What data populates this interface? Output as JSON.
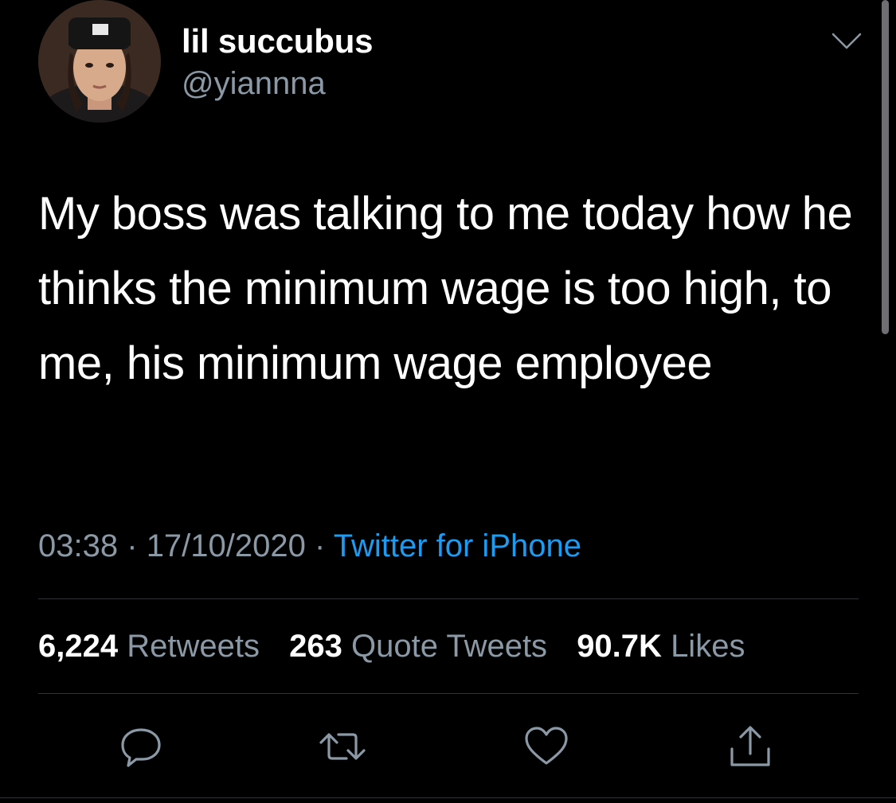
{
  "user": {
    "display_name": "lil succubus",
    "handle": "@yiannna"
  },
  "tweet": {
    "text": "My boss was talking to me today how he thinks the minimum wage is too high, to me, his minimum wage employee"
  },
  "meta": {
    "time": "03:38",
    "separator": "·",
    "date": "17/10/2020",
    "source": "Twitter for iPhone"
  },
  "stats": {
    "retweets_count": "6,224",
    "retweets_label": "Retweets",
    "quotes_count": "263",
    "quotes_label": "Quote Tweets",
    "likes_count": "90.7K",
    "likes_label": "Likes"
  },
  "icons": {
    "more": "chevron-down-icon",
    "reply": "reply-icon",
    "retweet": "retweet-icon",
    "like": "heart-icon",
    "share": "share-icon"
  },
  "colors": {
    "background": "#000000",
    "text": "#ffffff",
    "secondary": "#8b98a5",
    "link": "#1d9bf0",
    "divider": "#2f3336"
  }
}
